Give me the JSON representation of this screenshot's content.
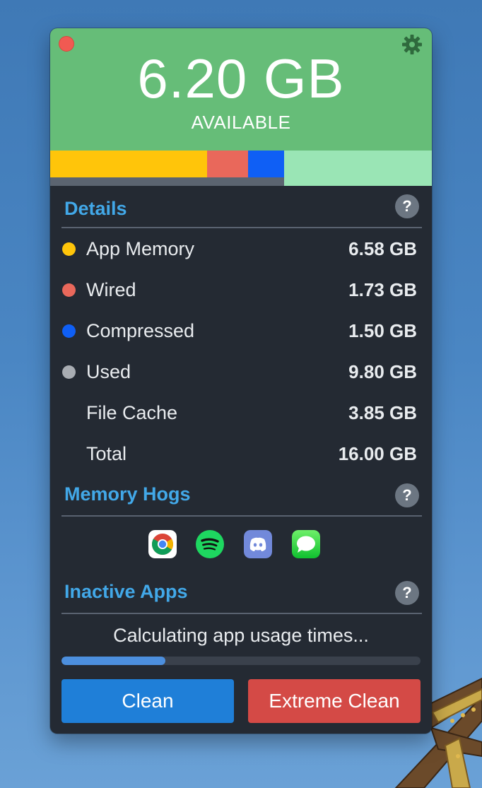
{
  "header": {
    "available_value": "6.20 GB",
    "available_label": "AVAILABLE",
    "background_color": "#66bd78"
  },
  "memory_bar": {
    "segments": [
      {
        "name": "App Memory",
        "fraction": 0.4113,
        "color": "#ffc50a"
      },
      {
        "name": "Wired",
        "fraction": 0.1081,
        "color": "#e9685b"
      },
      {
        "name": "Compressed",
        "fraction": 0.0938,
        "color": "#0f5ff5"
      }
    ],
    "available_color": "#9ae5b5",
    "used_underline_color": "#5b6470"
  },
  "details": {
    "title": "Details",
    "help_label": "?",
    "rows": [
      {
        "label": "App Memory",
        "value": "6.58 GB",
        "dot_color": "#ffc50a"
      },
      {
        "label": "Wired",
        "value": "1.73 GB",
        "dot_color": "#e9685b"
      },
      {
        "label": "Compressed",
        "value": "1.50 GB",
        "dot_color": "#0f5ff5"
      },
      {
        "label": "Used",
        "value": "9.80 GB",
        "dot_color": "#a9adb3"
      },
      {
        "label": "File Cache",
        "value": "3.85 GB",
        "dot_color": ""
      },
      {
        "label": "Total",
        "value": "16.00 GB",
        "dot_color": ""
      }
    ]
  },
  "memory_hogs": {
    "title": "Memory Hogs",
    "help_label": "?",
    "apps": [
      {
        "icon": "chrome-icon"
      },
      {
        "icon": "spotify-icon"
      },
      {
        "icon": "discord-icon"
      },
      {
        "icon": "messages-icon"
      }
    ]
  },
  "inactive_apps": {
    "title": "Inactive Apps",
    "help_label": "?",
    "status": "Calculating app usage times...",
    "progress": 0.29
  },
  "buttons": {
    "clean_label": "Clean",
    "extreme_label": "Extreme Clean",
    "clean_color": "#1f7fd8",
    "extreme_color": "#d44a46"
  },
  "colors": {
    "panel_background": "#242a33",
    "accent": "#42a8e8"
  }
}
